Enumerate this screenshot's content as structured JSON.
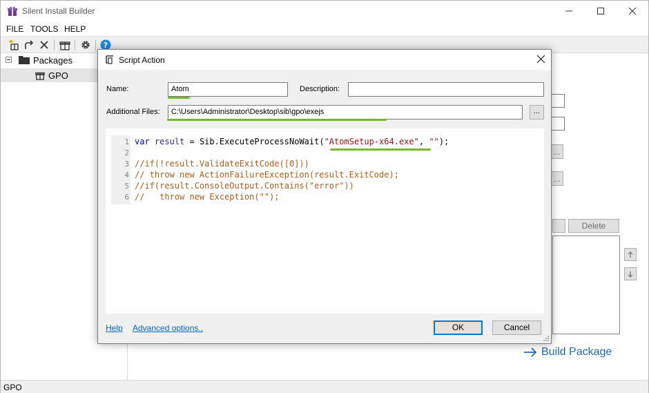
{
  "app": {
    "title": "Silent Install Builder",
    "status": "GPO"
  },
  "menu": [
    "FILE",
    "TOOLS",
    "HELP"
  ],
  "tree": {
    "root": "Packages",
    "child": "GPO"
  },
  "background": {
    "delete_label": "Delete",
    "browse_label": "...",
    "build_package_label": "Build Package"
  },
  "dialog": {
    "title": "Script Action",
    "name_label": "Name:",
    "name_value": "Atom",
    "description_label": "Description:",
    "description_value": "",
    "files_label": "Additional Files:",
    "files_value": "C:\\Users\\Administrator\\Desktop\\sib\\gpo\\exejs",
    "browse_label": "...",
    "code_lines": [
      {
        "n": "1"
      },
      {
        "n": "2"
      },
      {
        "n": "3",
        "text": "//if(!result.ValidateExitCode([0]))"
      },
      {
        "n": "4",
        "text": "// throw new ActionFailureException(result.ExitCode);"
      },
      {
        "n": "5",
        "text": "//if(result.ConsoleOutput.Contains(\"error\"))"
      },
      {
        "n": "6",
        "text": "//   throw new Exception(\"\");"
      }
    ],
    "line1": {
      "kw_var": "var",
      "ident": "result",
      "mid": " = Sib.ExecuteProcessNoWait(",
      "str1": "\"AtomSetup-x64.exe\"",
      "comma": ", ",
      "str2": "\"\"",
      "end": ");"
    },
    "help_link": "Help",
    "advanced_link": "Advanced options..",
    "ok_label": "OK",
    "cancel_label": "Cancel"
  },
  "colors": {
    "highlight_underline": "#76b82a",
    "link": "#0066cc",
    "build_package": "#1e6bb8"
  }
}
